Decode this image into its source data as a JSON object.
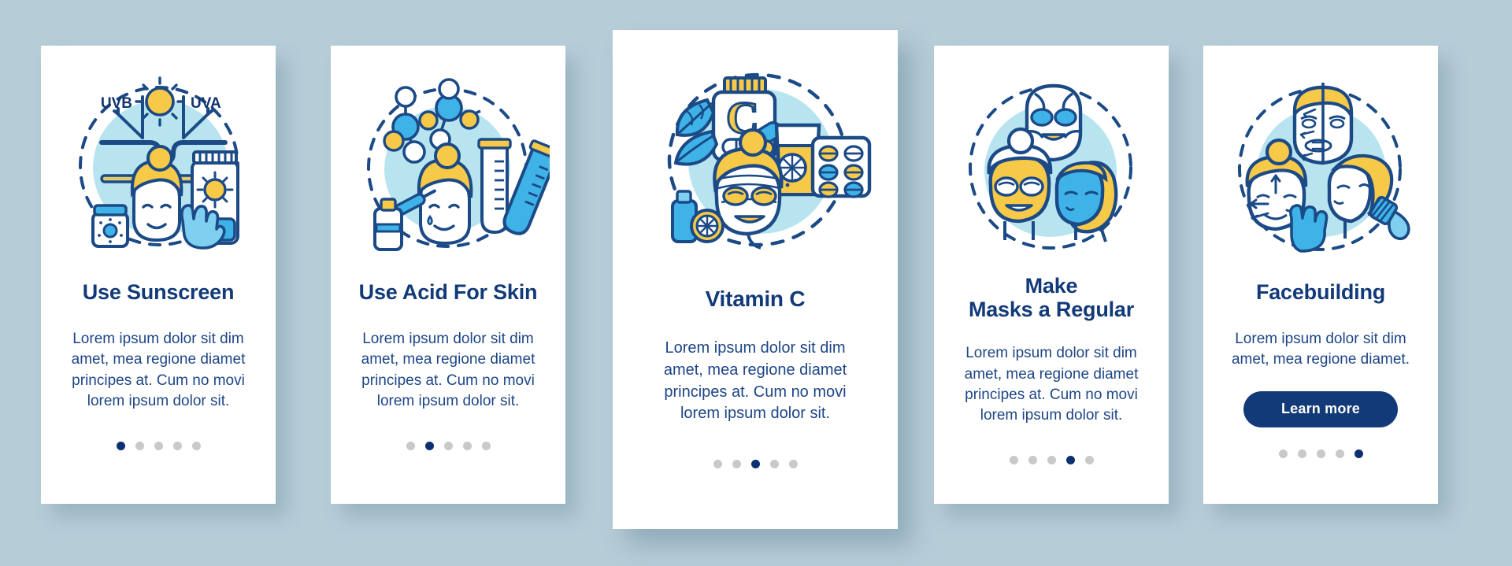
{
  "background_color": "#b6cdd8",
  "palette": {
    "card_bg": "#ffffff",
    "navy": "#123a78",
    "deep_navy": "#0e3070",
    "body_text": "#1d4586",
    "outline": "#1b4a86",
    "yellow": "#f7c948",
    "light_blue": "#b8e4f0",
    "mid_blue": "#3fb3e8",
    "dot_inactive": "#c8c9cb"
  },
  "screens": [
    {
      "id": "use-sunscreen",
      "title": "Use Sunscreen",
      "title_lines": [
        "Use Sunscreen"
      ],
      "body": "Lorem ipsum dolor sit dim amet, mea regione diamet principes at. Cum no movi lorem ipsum dolor sit.",
      "illustration": "sunscreen-illustration",
      "illustration_labels": [
        "UVB",
        "UVA"
      ],
      "button": null,
      "dots": {
        "count": 5,
        "active_index": 0
      }
    },
    {
      "id": "use-acid-for-skin",
      "title": "Use Acid For Skin",
      "title_lines": [
        "Use Acid For Skin"
      ],
      "body": "Lorem ipsum dolor sit dim amet, mea regione diamet principes at. Cum no movi lorem ipsum dolor sit.",
      "illustration": "acid-molecule-illustration",
      "illustration_labels": [],
      "button": null,
      "dots": {
        "count": 5,
        "active_index": 1
      }
    },
    {
      "id": "vitamin-c",
      "title": "Vitamin C",
      "title_lines": [
        "Vitamin C"
      ],
      "body": "Lorem ipsum dolor sit dim amet, mea regione diamet principes at. Cum no movi lorem ipsum dolor sit.",
      "illustration": "vitamin-c-illustration",
      "illustration_labels": [
        "C"
      ],
      "button": null,
      "dots": {
        "count": 5,
        "active_index": 2
      }
    },
    {
      "id": "make-masks-a-regular",
      "title": "Make Masks a Regular",
      "title_lines": [
        "Make",
        "Masks a Regular"
      ],
      "body": "Lorem ipsum dolor sit dim amet, mea regione diamet principes at. Cum no movi lorem ipsum dolor sit.",
      "illustration": "face-masks-illustration",
      "illustration_labels": [],
      "button": null,
      "dots": {
        "count": 5,
        "active_index": 3
      }
    },
    {
      "id": "facebuilding",
      "title": "Facebuilding",
      "title_lines": [
        "Facebuilding"
      ],
      "body": "Lorem ipsum dolor sit dim amet, mea regione diamet.",
      "illustration": "facebuilding-illustration",
      "illustration_labels": [],
      "button": {
        "label": "Learn more"
      },
      "dots": {
        "count": 5,
        "active_index": 4
      }
    }
  ]
}
